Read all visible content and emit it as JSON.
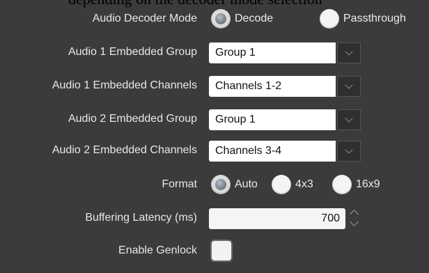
{
  "top_caption": "depending on the decoder mode selection",
  "rows": {
    "decoder_mode": {
      "label": "Audio Decoder Mode",
      "options": [
        {
          "label": "Decode",
          "selected": true
        },
        {
          "label": "Passthrough",
          "selected": false
        }
      ]
    },
    "audio1_group": {
      "label": "Audio 1 Embedded Group",
      "value": "Group 1"
    },
    "audio1_channels": {
      "label": "Audio 1 Embedded Channels",
      "value": "Channels 1-2"
    },
    "audio2_group": {
      "label": "Audio 2 Embedded Group",
      "value": "Group 1"
    },
    "audio2_channels": {
      "label": "Audio 2 Embedded Channels",
      "value": "Channels 3-4"
    },
    "format": {
      "label": "Format",
      "options": [
        {
          "label": "Auto",
          "selected": true
        },
        {
          "label": "4x3",
          "selected": false
        },
        {
          "label": "16x9",
          "selected": false
        }
      ]
    },
    "buffering_latency": {
      "label": "Buffering Latency (ms)",
      "value": "700"
    },
    "genlock": {
      "label": "Enable Genlock",
      "checked": false
    }
  },
  "icons": {
    "dropdown": "chevron-down-icon",
    "spinner_up": "chevron-up-icon",
    "spinner_down": "chevron-down-icon"
  },
  "colors": {
    "panel_background": "#3b3b3b",
    "label_text": "#e8e8e8",
    "field_background": "#ffffff"
  }
}
